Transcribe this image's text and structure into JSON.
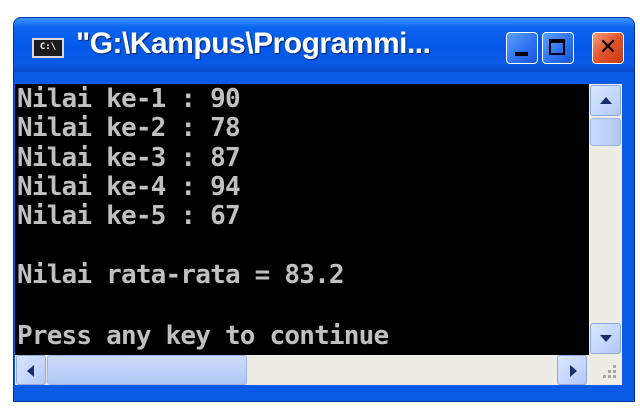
{
  "window": {
    "title": "\"G:\\Kampus\\Programmi...",
    "icon_label": "C:\\",
    "controls": [
      "minimize",
      "maximize",
      "close"
    ],
    "close_glyph": "✕"
  },
  "console": {
    "lines": [
      "Nilai ke-1 : 90",
      "Nilai ke-2 : 78",
      "Nilai ke-3 : 87",
      "Nilai ke-4 : 94",
      "Nilai ke-5 : 67",
      "",
      "Nilai rata-rata = 83.2",
      "",
      "Press any key to continue"
    ],
    "text_color": "#c0c0c0",
    "background": "#000000"
  },
  "icons": {
    "scroll_up": "triangle-up",
    "scroll_down": "triangle-down",
    "scroll_left": "triangle-left",
    "scroll_right": "triangle-right"
  },
  "colors": {
    "titlebar": "#0a5ae8",
    "close_button": "#e3532b",
    "scrollbar_track": "#eeede5"
  }
}
